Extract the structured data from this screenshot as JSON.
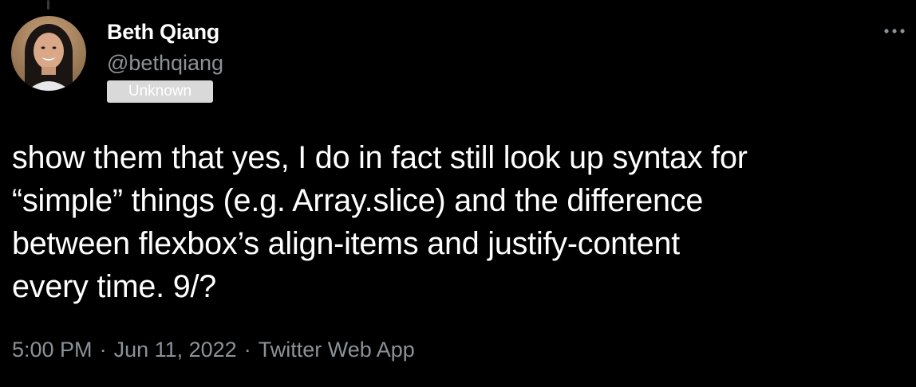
{
  "author": {
    "name": "Beth Qiang",
    "handle": "@bethqiang",
    "badge": "Unknown"
  },
  "tweet": {
    "text": "show them that yes, I do in fact still look up syntax for\n“simple” things (e.g. Array.slice) and the difference\nbetween flexbox’s align-items and justify-content\nevery time. 9/?"
  },
  "meta": {
    "time": "5:00 PM",
    "separator": "·",
    "date": "Jun 11, 2022",
    "source": "Twitter Web App"
  },
  "icons": {
    "more": "more-dots-icon",
    "avatar": "avatar-photo"
  },
  "colors": {
    "background": "#000000",
    "primary_text": "#ffffff",
    "secondary_text": "#8b9298",
    "badge_bg": "#d9d9d9"
  }
}
